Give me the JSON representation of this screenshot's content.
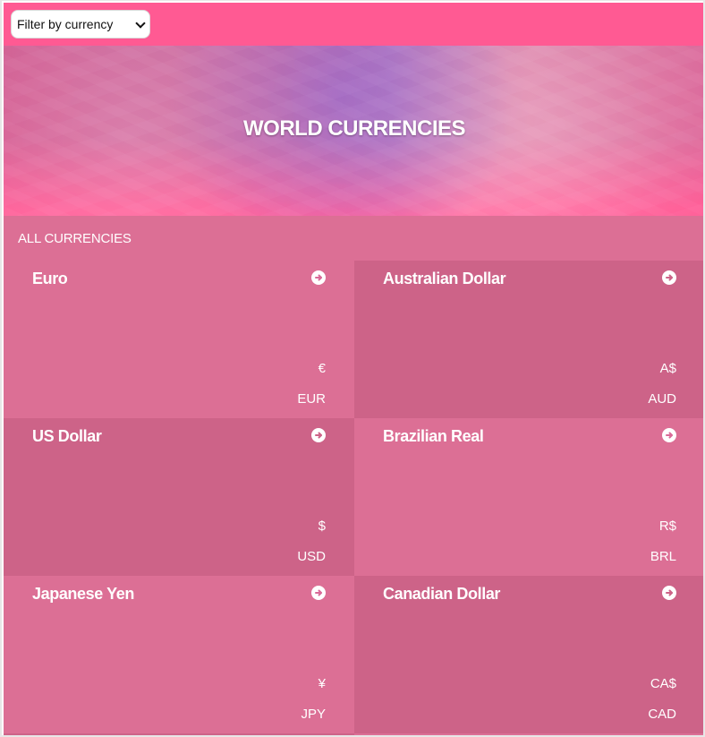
{
  "filter": {
    "selected": "Filter by currency"
  },
  "hero": {
    "title": "WORLD CURRENCIES"
  },
  "section": {
    "title": "ALL CURRENCIES"
  },
  "currencies": [
    {
      "name": "Euro",
      "symbol": "€",
      "code": "EUR",
      "shade": "light"
    },
    {
      "name": "Australian Dollar",
      "symbol": "A$",
      "code": "AUD",
      "shade": "dark"
    },
    {
      "name": "US Dollar",
      "symbol": "$",
      "code": "USD",
      "shade": "dark"
    },
    {
      "name": "Brazilian Real",
      "symbol": "R$",
      "code": "BRL",
      "shade": "light"
    },
    {
      "name": "Japanese Yen",
      "symbol": "¥",
      "code": "JPY",
      "shade": "light"
    },
    {
      "name": "Canadian Dollar",
      "symbol": "CA$",
      "code": "CAD",
      "shade": "dark"
    }
  ],
  "colors": {
    "topbar": "#ff5a93",
    "card_light": "#dc6f95",
    "card_dark": "#cd6388",
    "text": "#ffffff"
  },
  "icons": {
    "filter_dropdown": "chevron-down-icon",
    "card_action": "arrow-right-circle-icon"
  }
}
